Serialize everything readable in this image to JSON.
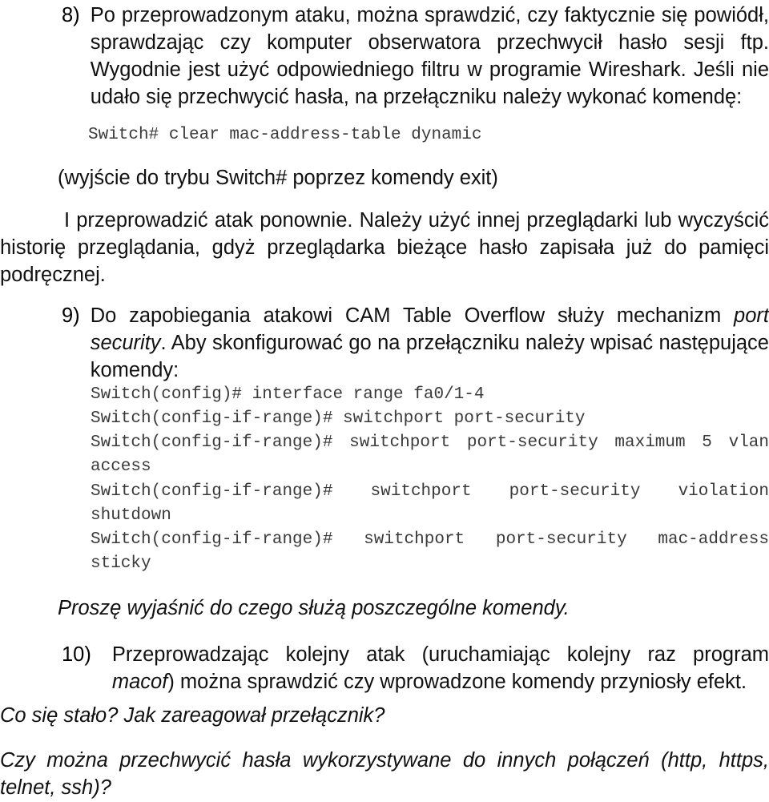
{
  "document": {
    "language": "pl",
    "background_color": "#ffffff",
    "text_color": "#111111",
    "mono_color": "#3a3a3a"
  },
  "items": {
    "item8": {
      "number": "8)",
      "paragraph": "Po przeprowadzonym ataku, można sprawdzić, czy faktycznie się powiódł, sprawdzając czy komputer obserwatora przechwycił hasło sesji ftp. Wygodnie jest użyć odpowiedniego filtru w programie Wireshark. Jeśli nie udało się przechwycić hasła, na przełączniku należy wykonać komendę:",
      "command": "Switch# clear mac-address-table dynamic",
      "note": "(wyjście do trybu Switch# poprzez komendy exit)",
      "followup": "I przeprowadzić atak ponownie. Należy użyć innej przeglądarki lub wyczyścić historię  przeglądania, gdyż przeglądarka bieżące hasło zapisała już do pamięci podręcznej."
    },
    "item9": {
      "number": "9)",
      "paragraph_part1": "Do zapobiegania atakowi CAM Table Overflow służy mechanizm ",
      "paragraph_emphasis1": "port security",
      "paragraph_part2": ". Aby skonfigurować go na przełączniku należy wpisać następujące komendy:",
      "commands": [
        "Switch(config)# interface range fa0/1-4",
        "Switch(config-if-range)# switchport port-security",
        "Switch(config-if-range)# switchport port-security maximum 5 vlan access",
        "Switch(config-if-range)# switchport port-security violation shutdown",
        "Switch(config-if-range)# switchport port-security mac-address sticky"
      ],
      "closing_note": "Proszę wyjaśnić do czego służą poszczególne komendy."
    },
    "item10": {
      "number": "10)",
      "paragraph_part1": "Przeprowadzając kolejny atak (uruchamiając kolejny raz program ",
      "paragraph_emphasis1": "macof",
      "paragraph_part2": ")  można sprawdzić czy wprowadzone komendy przyniosły efekt."
    }
  },
  "questions": {
    "q1": "Co się stało? Jak zareagował przełącznik?",
    "q2": "Czy można przechwycić hasła wykorzystywane do innych połączeń (http, https, telnet, ssh)?"
  }
}
